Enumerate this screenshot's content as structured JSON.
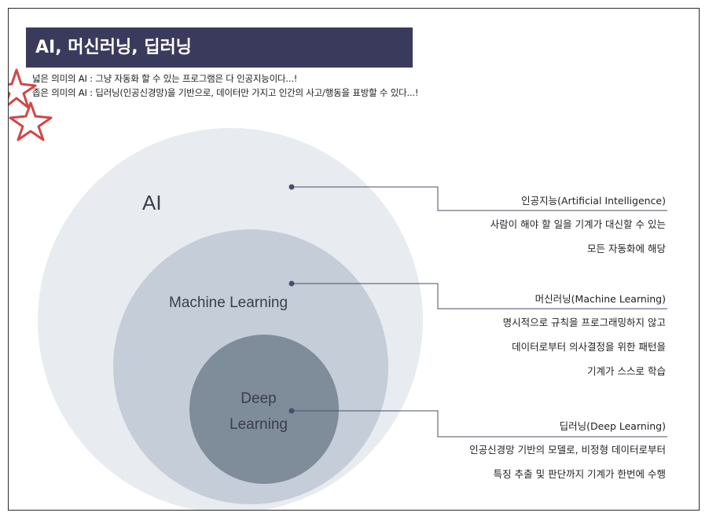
{
  "slide": {
    "title": "AI, 머신러닝, 딥러닝",
    "description": [
      "넓은 의미의 AI : 그냥 자동화 할 수 있는 프로그램은 다 인공지능이다...!",
      "좁은 의미의 AI : 딥러닝(인공신경망)을 기반으로, 데이터만 가지고 인간의 사고/행동을 표방할 수 있다...!"
    ]
  },
  "diagram": {
    "colors": {
      "ai_circle": "#e8ebef",
      "ml_circle": "#c4cdd8",
      "dl_circle": "#7f8c9a",
      "connector": "#4a4e6a",
      "star": "#d24646"
    },
    "circles": {
      "ai": "AI",
      "ml": "Machine Learning",
      "dl_line1": "Deep",
      "dl_line2": "Learning"
    },
    "descriptions": {
      "ai": {
        "title": "인공지능(Artificial Intelligence)",
        "lines": [
          "사람이 해야 할 일을 기계가 대신할 수 있는",
          "모든 자동화에 해당"
        ]
      },
      "ml": {
        "title": "머신러닝(Machine Learning)",
        "lines": [
          "명시적으로 규칙을 프로그래밍하지 않고",
          "데이터로부터 의사결정을 위한 패턴을",
          "기계가 스스로 학습"
        ]
      },
      "dl": {
        "title": "딥러닝(Deep Learning)",
        "lines": [
          "인공신경망 기반의 모델로, 비정형 데이터로부터",
          "특징 추출 및 판단까지 기계가 한번에 수행"
        ]
      }
    }
  }
}
